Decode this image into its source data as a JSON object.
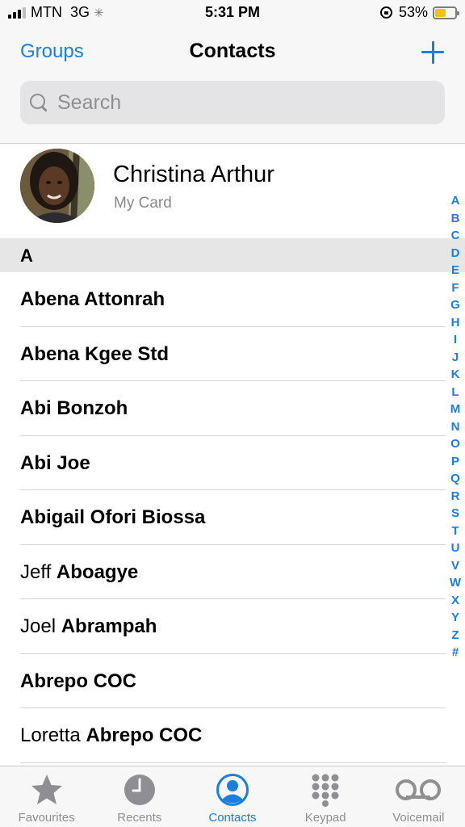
{
  "status_bar": {
    "carrier": "MTN",
    "network": "3G",
    "time": "5:31 PM",
    "battery": "53%",
    "battery_level": 0.53,
    "battery_color": "#f4c20d"
  },
  "nav": {
    "left_label": "Groups",
    "title": "Contacts",
    "add_icon": "plus-icon",
    "accent": "#1a7fe0"
  },
  "search": {
    "placeholder": "Search",
    "value": ""
  },
  "my_card": {
    "name": "Christina Arthur",
    "subtitle": "My Card"
  },
  "section": {
    "letter": "A"
  },
  "contacts": [
    {
      "first": "",
      "last": "Abena Attonrah"
    },
    {
      "first": "",
      "last": "Abena Kgee Std"
    },
    {
      "first": "",
      "last": "Abi Bonzoh"
    },
    {
      "first": "",
      "last": "Abi Joe"
    },
    {
      "first": "",
      "last": "Abigail Ofori Biossa"
    },
    {
      "first": "Jeff ",
      "last": "Aboagye"
    },
    {
      "first": "Joel ",
      "last": "Abrampah"
    },
    {
      "first": "",
      "last": "Abrepo COC"
    },
    {
      "first": "Loretta ",
      "last": "Abrepo COC"
    }
  ],
  "index_letters": [
    "A",
    "B",
    "C",
    "D",
    "E",
    "F",
    "G",
    "H",
    "I",
    "J",
    "K",
    "L",
    "M",
    "N",
    "O",
    "P",
    "Q",
    "R",
    "S",
    "T",
    "U",
    "V",
    "W",
    "X",
    "Y",
    "Z",
    "#"
  ],
  "tabs": [
    {
      "label": "Favourites",
      "icon": "star-icon",
      "active": false
    },
    {
      "label": "Recents",
      "icon": "clock-icon",
      "active": false
    },
    {
      "label": "Contacts",
      "icon": "person-icon",
      "active": true
    },
    {
      "label": "Keypad",
      "icon": "keypad-icon",
      "active": false
    },
    {
      "label": "Voicemail",
      "icon": "voicemail-icon",
      "active": false
    }
  ]
}
